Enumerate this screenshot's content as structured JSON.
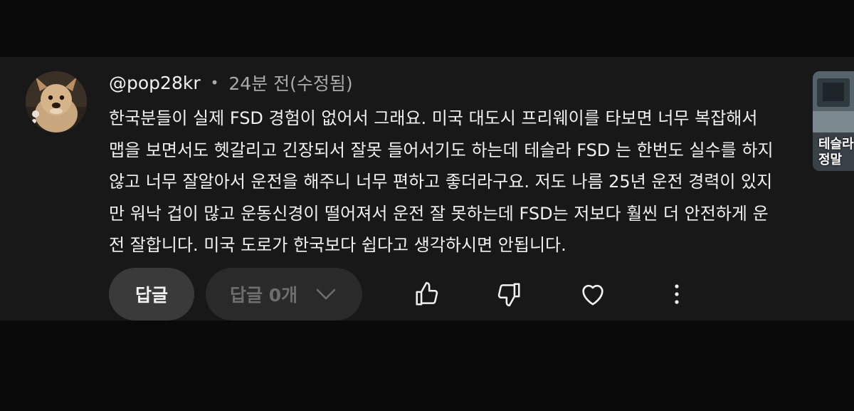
{
  "comment": {
    "author": "@pop28kr",
    "separator": "•",
    "time": "24분 전(수정됨)",
    "lines": [
      "한국분들이 실제 FSD 경험이 없어서 그래요. 미국 대도시 프리웨이를 타보면 너무 복잡해서",
      "맵을 보면서도 헷갈리고 긴장되서 잘못 들어서기도 하는데 테슬라 FSD 는 한번도 실수를 하지",
      "않고 너무 잘알아서 운전을 해주니 너무 편하고 좋더라구요. 저도 나름 25년 운전 경력이 있지",
      "만 워낙 겁이 많고 운동신경이 떨어져서 운전 잘 못하는데 FSD는 저보다 훨씬 더 안전하게 운",
      "전 잘합니다. 미국 도로가 한국보다 쉽다고 생각하시면 안됩니다."
    ]
  },
  "actions": {
    "reply_label": "답글",
    "replies_label": "답글 0개"
  },
  "thumbnail": {
    "line1": "테슬라",
    "line2": "정말"
  },
  "icons": {
    "like": "thumbs-up-icon",
    "dislike": "thumbs-down-icon",
    "heart": "heart-icon",
    "more": "more-vertical-icon",
    "expand": "chevron-down-icon"
  },
  "colors": {
    "background": "#0a0a0a",
    "card": "#181818",
    "text": "#f1f1f1",
    "muted": "#aaaaaa",
    "button": "#3a3a3a"
  }
}
